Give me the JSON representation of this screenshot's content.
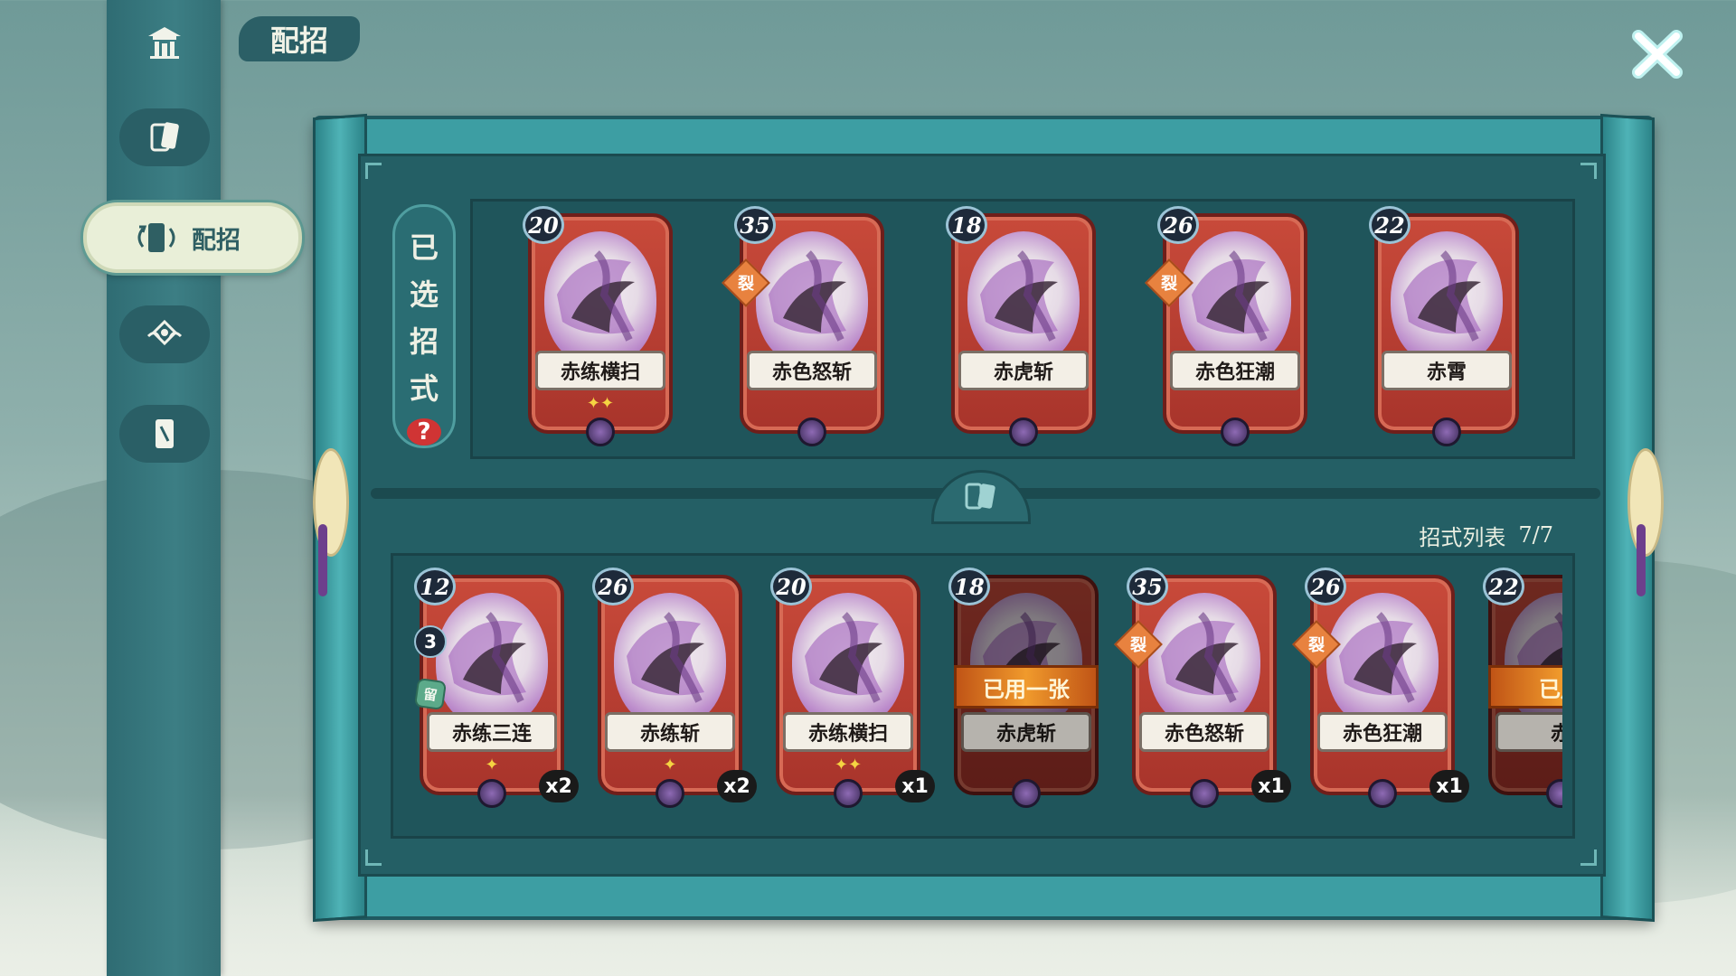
{
  "page": {
    "title": "配招"
  },
  "sidebar": {
    "items": [
      {
        "icon": "pavilion-icon"
      },
      {
        "icon": "cards-icon"
      },
      {
        "label": "配招",
        "icon": "deck-icon",
        "active": true
      },
      {
        "icon": "emblem-icon"
      },
      {
        "icon": "card-single-icon"
      }
    ]
  },
  "selected": {
    "label_chars": [
      "已",
      "选",
      "招",
      "式"
    ],
    "help_label": "?",
    "cards": [
      {
        "name": "赤练横扫",
        "cost": "20",
        "stars": "✦✦",
        "split": ""
      },
      {
        "name": "赤色怒斩",
        "cost": "35",
        "stars": "",
        "split": "裂"
      },
      {
        "name": "赤虎斩",
        "cost": "18",
        "stars": "",
        "split": ""
      },
      {
        "name": "赤色狂潮",
        "cost": "26",
        "stars": "",
        "split": "裂"
      },
      {
        "name": "赤霄",
        "cost": "22",
        "stars": "",
        "split": ""
      }
    ]
  },
  "list": {
    "header_label": "招式列表",
    "header_count": "7/7",
    "cards": [
      {
        "name": "赤练三连",
        "cost": "12",
        "stars": "✦",
        "count": "x2",
        "sub_cost": "3",
        "retain": "留",
        "split": "",
        "used": ""
      },
      {
        "name": "赤练斩",
        "cost": "26",
        "stars": "✦",
        "count": "x2",
        "sub_cost": "",
        "retain": "",
        "split": "",
        "used": ""
      },
      {
        "name": "赤练横扫",
        "cost": "20",
        "stars": "✦✦",
        "count": "x1",
        "sub_cost": "",
        "retain": "",
        "split": "",
        "used": ""
      },
      {
        "name": "赤虎斩",
        "cost": "18",
        "stars": "",
        "count": "",
        "sub_cost": "",
        "retain": "",
        "split": "",
        "used": "已用一张"
      },
      {
        "name": "赤色怒斩",
        "cost": "35",
        "stars": "",
        "count": "x1",
        "sub_cost": "",
        "retain": "",
        "split": "裂",
        "used": ""
      },
      {
        "name": "赤色狂潮",
        "cost": "26",
        "stars": "",
        "count": "x1",
        "sub_cost": "",
        "retain": "",
        "split": "裂",
        "used": ""
      },
      {
        "name": "赤",
        "cost": "22",
        "stars": "",
        "count": "",
        "sub_cost": "",
        "retain": "",
        "split": "",
        "used": "已用"
      }
    ]
  },
  "colors": {
    "card_red": "#b63a2f",
    "board_teal": "#3d9ea3",
    "panel_dark": "#1f555b",
    "used_orange": "#e0802a",
    "purple_energy": "#8b4ea4"
  }
}
